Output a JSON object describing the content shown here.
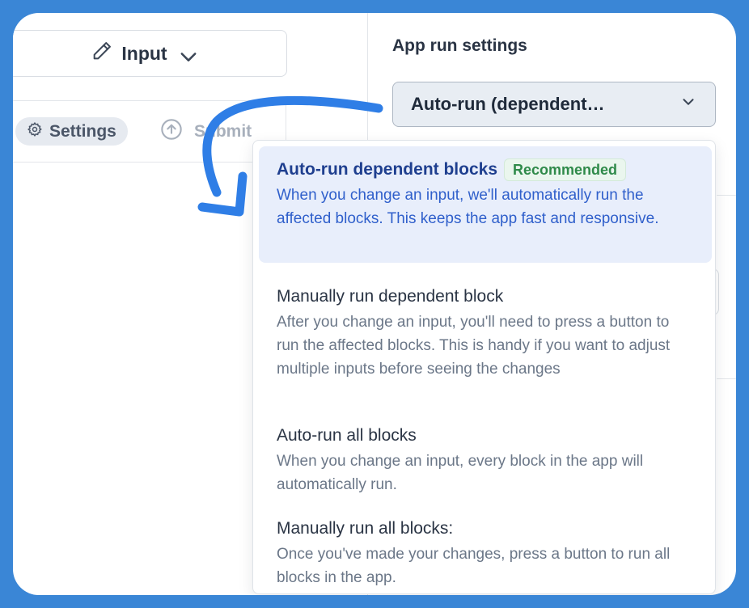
{
  "left_pane": {
    "input_button_label": "Input",
    "tabs": [
      {
        "label": "Settings",
        "active": true
      },
      {
        "label": "Submit",
        "active": false
      }
    ]
  },
  "right_pane": {
    "title": "App run settings",
    "run_mode_select": {
      "value": "Auto-run (dependent…"
    },
    "options": [
      {
        "title": "Auto-run dependent blocks",
        "badge": "Recommended",
        "description": "When you change an input, we'll automatically run the affected blocks. This keeps the app fast and responsive.",
        "selected": true
      },
      {
        "title": "Manually run dependent block",
        "description": "After you change an input, you'll need to press a button to run the affected blocks. This is handy if you want to adjust multiple inputs before seeing the changes",
        "selected": false
      },
      {
        "title": "Auto-run all blocks",
        "description": "When you change an input, every block in the app will automatically run.",
        "selected": false
      },
      {
        "title": "Manually run all blocks:",
        "description": "Once you've made your changes, press a button to run all blocks in the app.",
        "selected": false
      }
    ]
  },
  "colors": {
    "background": "#3a86d6",
    "arrow": "#2f7ee6",
    "selected_bg": "#e8eefb",
    "badge_green": "#2f8a4a"
  },
  "icons": [
    "pencil-icon",
    "chevron-down-icon",
    "gear-icon",
    "arrow-up-circle-icon",
    "curved-arrow-annotation"
  ]
}
